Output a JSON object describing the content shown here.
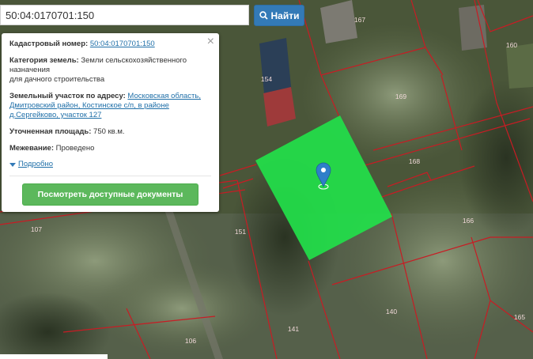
{
  "search": {
    "value": "50:04:0170701:150",
    "button_label": "Найти"
  },
  "popup": {
    "cadastral_label": "Кадастровый номер:",
    "cadastral_value": "50:04:0170701:150",
    "category_label": "Категория земель:",
    "category_value_1": "Земли сельскохозяйственного",
    "category_value_2": "назначения",
    "category_value_3": "для дачного строительства",
    "address_label": "Земельный участок по адресу:",
    "address_value_1": "Московская область,",
    "address_value_2": "Дмитровский район, Костинское с/п, в районе",
    "address_value_3": "д.Сергейково, участок 127",
    "area_label": "Уточненная площадь:",
    "area_value": "750 кв.м.",
    "survey_label": "Межевание:",
    "survey_value": "Проведено",
    "more_label": "Подробно",
    "docs_button": "Посмотреть доступные документы",
    "close_glyph": "×"
  },
  "map": {
    "parcel_labels": [
      "167",
      "160",
      "154",
      "169",
      "168",
      "166",
      "107",
      "151",
      "140",
      "141",
      "165",
      "106"
    ],
    "selected_parcel_color": "#22e04a",
    "boundary_color": "#c81c24",
    "marker_color": "#2f7fc9"
  }
}
